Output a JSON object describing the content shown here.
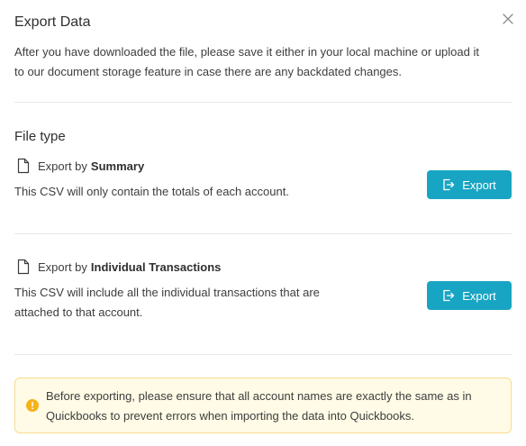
{
  "modal": {
    "title": "Export Data",
    "close_icon": "close-icon",
    "intro": "After you have downloaded the file, please save it either in your local machine or upload it to our document storage feature in case there are any backdated changes."
  },
  "file_type": {
    "heading": "File type",
    "options": [
      {
        "icon": "file-icon",
        "prefix": "Export by",
        "name": "Summary",
        "description": "This CSV will only contain the totals of each account.",
        "button_label": "Export",
        "button_icon": "export-icon"
      },
      {
        "icon": "file-icon",
        "prefix": "Export by",
        "name": "Individual Transactions",
        "description": "This CSV will include all the individual transactions that are attached to that account.",
        "button_label": "Export",
        "button_icon": "export-icon"
      }
    ]
  },
  "warning": {
    "icon": "warning-icon",
    "text": "Before exporting, please ensure that all account names are exactly the same as in Quickbooks to prevent errors when importing the data into Quickbooks."
  },
  "colors": {
    "accent": "#18a5c3",
    "warning_bg": "#fffbe6",
    "warning_border": "#f5dd8f",
    "warning_icon": "#f5b21b"
  }
}
